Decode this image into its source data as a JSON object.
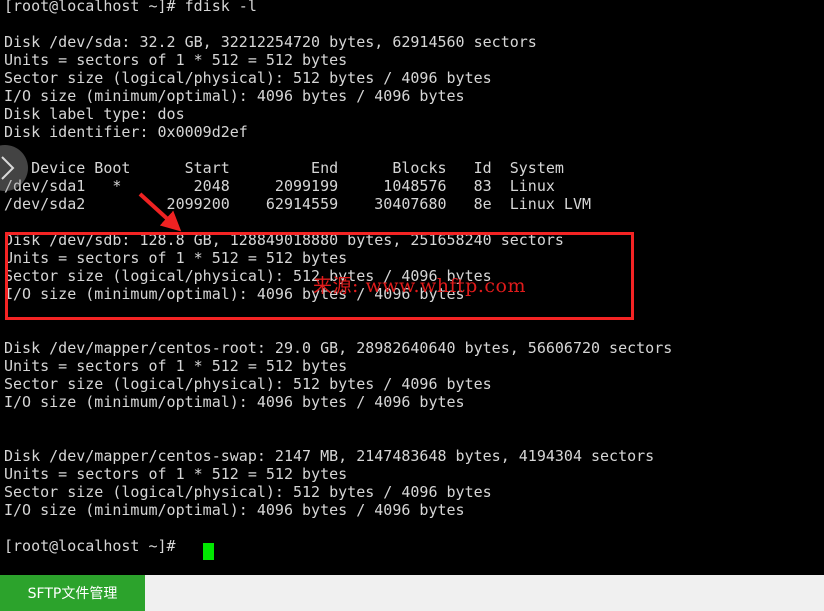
{
  "terminal": {
    "prompt_top": "[root@localhost ~]# fdisk -l",
    "lines": [
      "[root@localhost ~]# fdisk -l",
      "",
      "Disk /dev/sda: 32.2 GB, 32212254720 bytes, 62914560 sectors",
      "Units = sectors of 1 * 512 = 512 bytes",
      "Sector size (logical/physical): 512 bytes / 4096 bytes",
      "I/O size (minimum/optimal): 4096 bytes / 4096 bytes",
      "Disk label type: dos",
      "Disk identifier: 0x0009d2ef",
      "",
      "   Device Boot      Start         End      Blocks   Id  System",
      "/dev/sda1   *        2048     2099199     1048576   83  Linux",
      "/dev/sda2         2099200    62914559    30407680   8e  Linux LVM",
      "",
      "Disk /dev/sdb: 128.8 GB, 128849018880 bytes, 251658240 sectors",
      "Units = sectors of 1 * 512 = 512 bytes",
      "Sector size (logical/physical): 512 bytes / 4096 bytes",
      "I/O size (minimum/optimal): 4096 bytes / 4096 bytes",
      "",
      "",
      "Disk /dev/mapper/centos-root: 29.0 GB, 28982640640 bytes, 56606720 sectors",
      "Units = sectors of 1 * 512 = 512 bytes",
      "Sector size (logical/physical): 512 bytes / 4096 bytes",
      "I/O size (minimum/optimal): 4096 bytes / 4096 bytes",
      "",
      "",
      "Disk /dev/mapper/centos-swap: 2147 MB, 2147483648 bytes, 4194304 sectors",
      "Units = sectors of 1 * 512 = 512 bytes",
      "Sector size (logical/physical): 512 bytes / 4096 bytes",
      "I/O size (minimum/optimal): 4096 bytes / 4096 bytes",
      "",
      "[root@localhost ~]#"
    ],
    "partition_table": {
      "headers": [
        "Device",
        "Boot",
        "Start",
        "End",
        "Blocks",
        "Id",
        "System"
      ],
      "rows": [
        [
          "/dev/sda1",
          "*",
          "2048",
          "2099199",
          "1048576",
          "83",
          "Linux"
        ],
        [
          "/dev/sda2",
          "",
          "2099200",
          "62914559",
          "30407680",
          "8e",
          "Linux LVM"
        ]
      ]
    },
    "disks": [
      {
        "device": "/dev/sda",
        "size": "32.2 GB",
        "bytes": "32212254720 bytes",
        "sectors": "62914560 sectors",
        "units": "sectors of 1 * 512 = 512 bytes",
        "sector_size": "512 bytes / 4096 bytes",
        "io_size": "4096 bytes / 4096 bytes",
        "label_type": "dos",
        "identifier": "0x0009d2ef"
      },
      {
        "device": "/dev/sdb",
        "size": "128.8 GB",
        "bytes": "128849018880 bytes",
        "sectors": "251658240 sectors",
        "units": "sectors of 1 * 512 = 512 bytes",
        "sector_size": "512 bytes / 4096 bytes",
        "io_size": "4096 bytes / 4096 bytes"
      },
      {
        "device": "/dev/mapper/centos-root",
        "size": "29.0 GB",
        "bytes": "28982640640 bytes",
        "sectors": "56606720 sectors",
        "units": "sectors of 1 * 512 = 512 bytes",
        "sector_size": "512 bytes / 4096 bytes",
        "io_size": "4096 bytes / 4096 bytes"
      },
      {
        "device": "/dev/mapper/centos-swap",
        "size": "2147 MB",
        "bytes": "2147483648 bytes",
        "sectors": "4194304 sectors",
        "units": "sectors of 1 * 512 = 512 bytes",
        "sector_size": "512 bytes / 4096 bytes",
        "io_size": "4096 bytes / 4096 bytes"
      }
    ],
    "prompt_bottom": "[root@localhost ~]#",
    "colors": {
      "background": "#000000",
      "text": "#d6d6d6",
      "cursor": "#00e800"
    }
  },
  "annotations": {
    "highlight_box_color": "#f42424",
    "arrow_color": "#ee2222",
    "watermark": "来源: www.whftp.com",
    "watermark_color": "#e01b1b"
  },
  "tabbar": {
    "sftp_label": "SFTP文件管理",
    "sftp_color": "#2ca32c"
  },
  "scroll_button": {
    "icon": "chevron-right-icon"
  }
}
